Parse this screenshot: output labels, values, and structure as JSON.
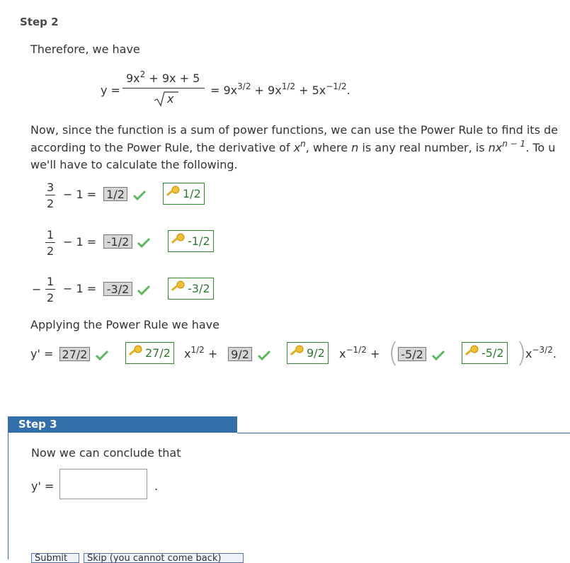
{
  "step2": {
    "label": "Step 2",
    "therefore": "Therefore, we have",
    "eq1": {
      "lhs": "y =",
      "numerator_a": "9x",
      "numerator_a_exp": "2",
      "numerator_b": " + 9x + 5",
      "denominator": "x",
      "rhs_a": "= 9x",
      "rhs_a_exp": "3/2",
      "rhs_b": " + 9x",
      "rhs_b_exp": "1/2",
      "rhs_c": " + 5x",
      "rhs_c_exp": "−1/2",
      "rhs_end": "."
    },
    "para1_line1": "Now, since the function is a sum of power functions, we can use the Power Rule to find its de",
    "para1_line2_a": "according to the Power Rule, the derivative of ",
    "para1_line2_x": "x",
    "para1_line2_n": "n",
    "para1_line2_b": ", where ",
    "para1_line2_n2": "n",
    "para1_line2_c": " is any real number, is ",
    "para1_line2_nx": "nx",
    "para1_line2_exp": "n − 1",
    "para1_line2_d": ". To u",
    "para1_line3": "we'll have to calculate the following.",
    "calc": [
      {
        "sign": "",
        "num": "3",
        "den": "2",
        "op": "− 1 =",
        "answer": "1/2",
        "key": "1/2"
      },
      {
        "sign": "",
        "num": "1",
        "den": "2",
        "op": "− 1 =",
        "answer": "-1/2",
        "key": "-1/2"
      },
      {
        "sign": "−",
        "num": "1",
        "den": "2",
        "op": "− 1 =",
        "answer": "-3/2",
        "key": "-3/2"
      }
    ],
    "applying": "Applying the Power Rule we have",
    "deriv": {
      "lhs": "y' =",
      "a1": "27/2",
      "k1": "27/2",
      "t1": "x",
      "t1_exp": "1/2",
      "plus1": "+",
      "a2": "9/2",
      "k2": "9/2",
      "t2": "x",
      "t2_exp": "−1/2",
      "plus2": "+",
      "a3": "-5/2",
      "k3": "-5/2",
      "t3": "x",
      "t3_exp": "−3/2",
      "end": "."
    }
  },
  "step3": {
    "label": "Step 3",
    "conclude": "Now we can conclude that",
    "lhs": "y' =",
    "period": ".",
    "input_value": "",
    "submit_label": "Submit",
    "skip_label": "Skip (you cannot come back)"
  },
  "colors": {
    "accent": "#3370ab",
    "check": "#5cb85c",
    "key_border": "#2f8a2f",
    "answer_bg": "#d6d6d6"
  },
  "icons": [
    "check-icon",
    "key-icon"
  ]
}
